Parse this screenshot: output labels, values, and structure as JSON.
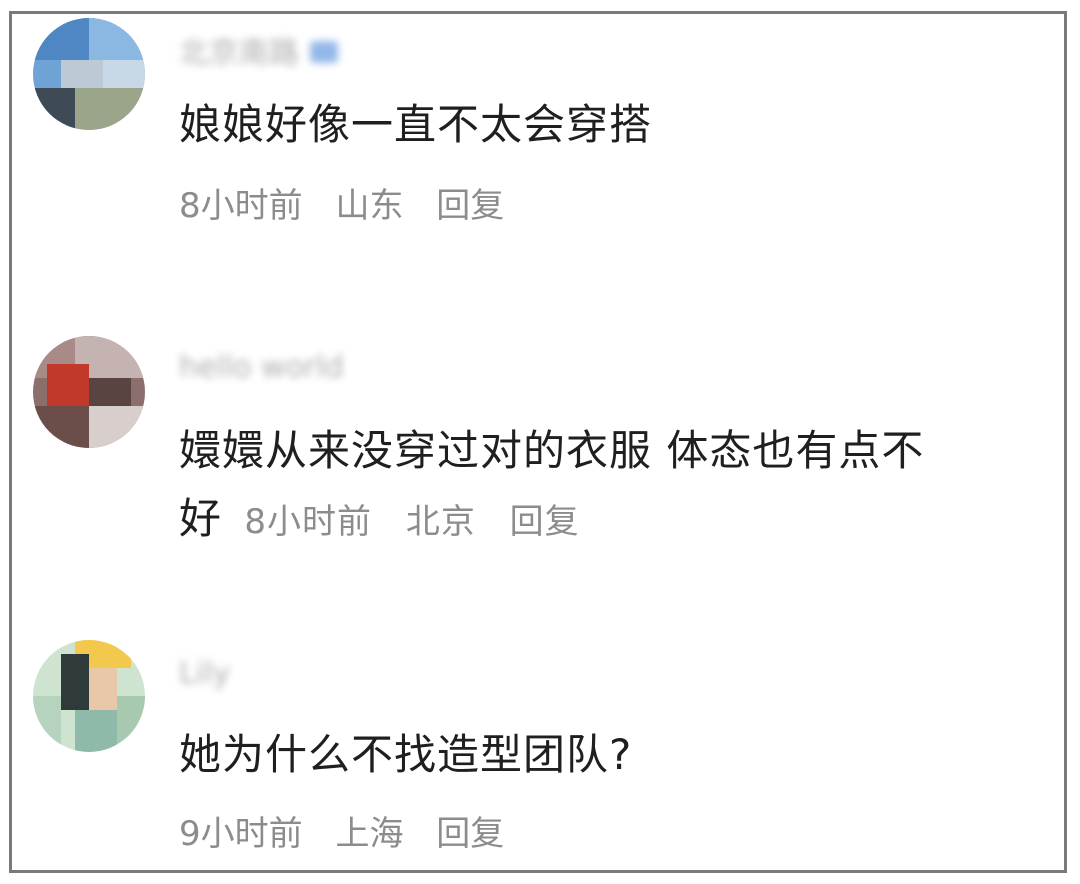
{
  "comments": [
    {
      "username": "北京南路",
      "text": "娘娘好像一直不太会穿搭",
      "time": "8小时前",
      "location": "山东",
      "reply_label": "回复"
    },
    {
      "username": "hello world",
      "text_line1": "嬛嬛从来没穿过对的衣服 体态也有点不",
      "text_line2": "好",
      "time": "8小时前",
      "location": "北京",
      "reply_label": "回复"
    },
    {
      "username": "Lily",
      "text": "她为什么不找造型团队?",
      "time": "9小时前",
      "location": "上海",
      "reply_label": "回复"
    }
  ],
  "colors": {
    "text": "#1f1f1f",
    "meta": "#8c8c8c",
    "border": "#7a7a7a",
    "background": "#ffffff"
  }
}
